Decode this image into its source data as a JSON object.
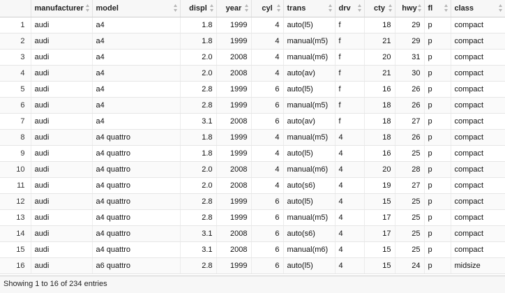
{
  "table": {
    "columns": [
      "",
      "manufacturer",
      "model",
      "displ",
      "year",
      "cyl",
      "trans",
      "drv",
      "cty",
      "hwy",
      "fl",
      "class"
    ],
    "rows": [
      [
        "1",
        "audi",
        "a4",
        "1.8",
        "1999",
        "4",
        "auto(l5)",
        "f",
        "18",
        "29",
        "p",
        "compact"
      ],
      [
        "2",
        "audi",
        "a4",
        "1.8",
        "1999",
        "4",
        "manual(m5)",
        "f",
        "21",
        "29",
        "p",
        "compact"
      ],
      [
        "3",
        "audi",
        "a4",
        "2.0",
        "2008",
        "4",
        "manual(m6)",
        "f",
        "20",
        "31",
        "p",
        "compact"
      ],
      [
        "4",
        "audi",
        "a4",
        "2.0",
        "2008",
        "4",
        "auto(av)",
        "f",
        "21",
        "30",
        "p",
        "compact"
      ],
      [
        "5",
        "audi",
        "a4",
        "2.8",
        "1999",
        "6",
        "auto(l5)",
        "f",
        "16",
        "26",
        "p",
        "compact"
      ],
      [
        "6",
        "audi",
        "a4",
        "2.8",
        "1999",
        "6",
        "manual(m5)",
        "f",
        "18",
        "26",
        "p",
        "compact"
      ],
      [
        "7",
        "audi",
        "a4",
        "3.1",
        "2008",
        "6",
        "auto(av)",
        "f",
        "18",
        "27",
        "p",
        "compact"
      ],
      [
        "8",
        "audi",
        "a4 quattro",
        "1.8",
        "1999",
        "4",
        "manual(m5)",
        "4",
        "18",
        "26",
        "p",
        "compact"
      ],
      [
        "9",
        "audi",
        "a4 quattro",
        "1.8",
        "1999",
        "4",
        "auto(l5)",
        "4",
        "16",
        "25",
        "p",
        "compact"
      ],
      [
        "10",
        "audi",
        "a4 quattro",
        "2.0",
        "2008",
        "4",
        "manual(m6)",
        "4",
        "20",
        "28",
        "p",
        "compact"
      ],
      [
        "11",
        "audi",
        "a4 quattro",
        "2.0",
        "2008",
        "4",
        "auto(s6)",
        "4",
        "19",
        "27",
        "p",
        "compact"
      ],
      [
        "12",
        "audi",
        "a4 quattro",
        "2.8",
        "1999",
        "6",
        "auto(l5)",
        "4",
        "15",
        "25",
        "p",
        "compact"
      ],
      [
        "13",
        "audi",
        "a4 quattro",
        "2.8",
        "1999",
        "6",
        "manual(m5)",
        "4",
        "17",
        "25",
        "p",
        "compact"
      ],
      [
        "14",
        "audi",
        "a4 quattro",
        "3.1",
        "2008",
        "6",
        "auto(s6)",
        "4",
        "17",
        "25",
        "p",
        "compact"
      ],
      [
        "15",
        "audi",
        "a4 quattro",
        "3.1",
        "2008",
        "6",
        "manual(m6)",
        "4",
        "15",
        "25",
        "p",
        "compact"
      ],
      [
        "16",
        "audi",
        "a6 quattro",
        "2.8",
        "1999",
        "6",
        "auto(l5)",
        "4",
        "15",
        "24",
        "p",
        "midsize"
      ]
    ]
  },
  "icons": {
    "sort": "sort-arrows-icon"
  },
  "colors": {
    "header_bg": "#f7f7f7",
    "row_alt_bg": "#fafafa",
    "border": "#cfcfcf"
  },
  "footer": {
    "info": "Showing 1 to 16 of 234 entries"
  }
}
